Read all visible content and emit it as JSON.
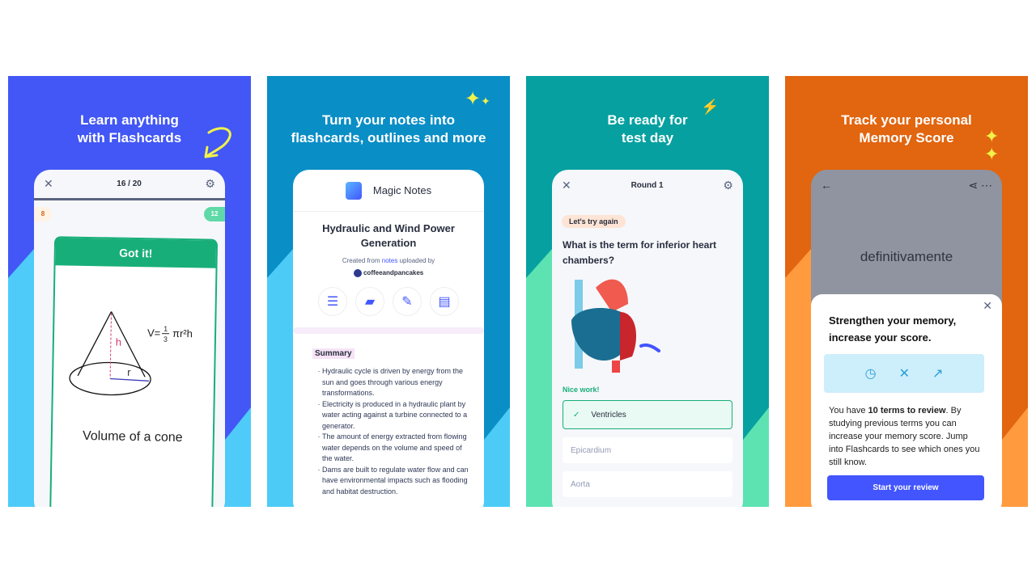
{
  "panels": [
    {
      "headline": [
        "Learn anything",
        "with Flashcards"
      ],
      "colors": {
        "top": "#4257F5",
        "bottom": "#4ECBF8"
      },
      "toolbar": {
        "progress": "16 / 20",
        "close_icon": "close-icon",
        "settings_icon": "gear-icon"
      },
      "still_learning_count": "8",
      "know_count": "12",
      "card": {
        "header": "Got it!",
        "formula": "V=",
        "fraction_num": "1",
        "fraction_den": "3",
        "formula_tail": "πr²h",
        "h_label": "h",
        "r_label": "r",
        "term": "Volume of a cone"
      }
    },
    {
      "headline": [
        "Turn your notes into",
        "flashcards, outlines and more"
      ],
      "colors": {
        "top": "#0A8EC6",
        "bottom": "#4CCBF7"
      },
      "app_title": "Magic Notes",
      "note_title": "Hydraulic and Wind Power Generation",
      "created_prefix": "Created from",
      "created_link": "notes",
      "created_suffix": "uploaded by",
      "username": "coffeeandpancakes",
      "actions": [
        "outline-icon",
        "flashcards-icon",
        "edit-icon",
        "document-icon"
      ],
      "summary_label": "Summary",
      "bullets": [
        "Hydraulic cycle is driven by energy from the sun and goes through various energy transformations.",
        "Electricity is produced in a hydraulic plant by water acting against a turbine connected to a generator.",
        "The amount of energy extracted from flowing water depends on the volume and speed of the water.",
        "Dams are built to regulate water flow and can have environmental impacts such as flooding and habitat destruction."
      ]
    },
    {
      "headline": [
        "Be ready for",
        "test day"
      ],
      "colors": {
        "top": "#06A0A0",
        "bottom": "#5CE3B1"
      },
      "toolbar": {
        "title": "Round 1"
      },
      "badge": "Let's try again",
      "question": "What is the term for inferior heart chambers?",
      "feedback": "Nice work!",
      "options": [
        "Ventricles",
        "Epicardium",
        "Aorta"
      ],
      "correct_index": 0
    },
    {
      "headline": [
        "Track your personal",
        "Memory Score"
      ],
      "colors": {
        "top": "#E2650F",
        "bottom": "#FF9B3E"
      },
      "card_term": "definitivamente",
      "modal_title": "Strengthen your memory, increase your score.",
      "body_prefix": "You have",
      "body_bold": "10 terms to review",
      "body_rest": ". By studying previous terms you can increase your memory score. Jump into Flashcards to see which ones you still know.",
      "cta": "Start your review",
      "accent": "#4255FF"
    }
  ]
}
